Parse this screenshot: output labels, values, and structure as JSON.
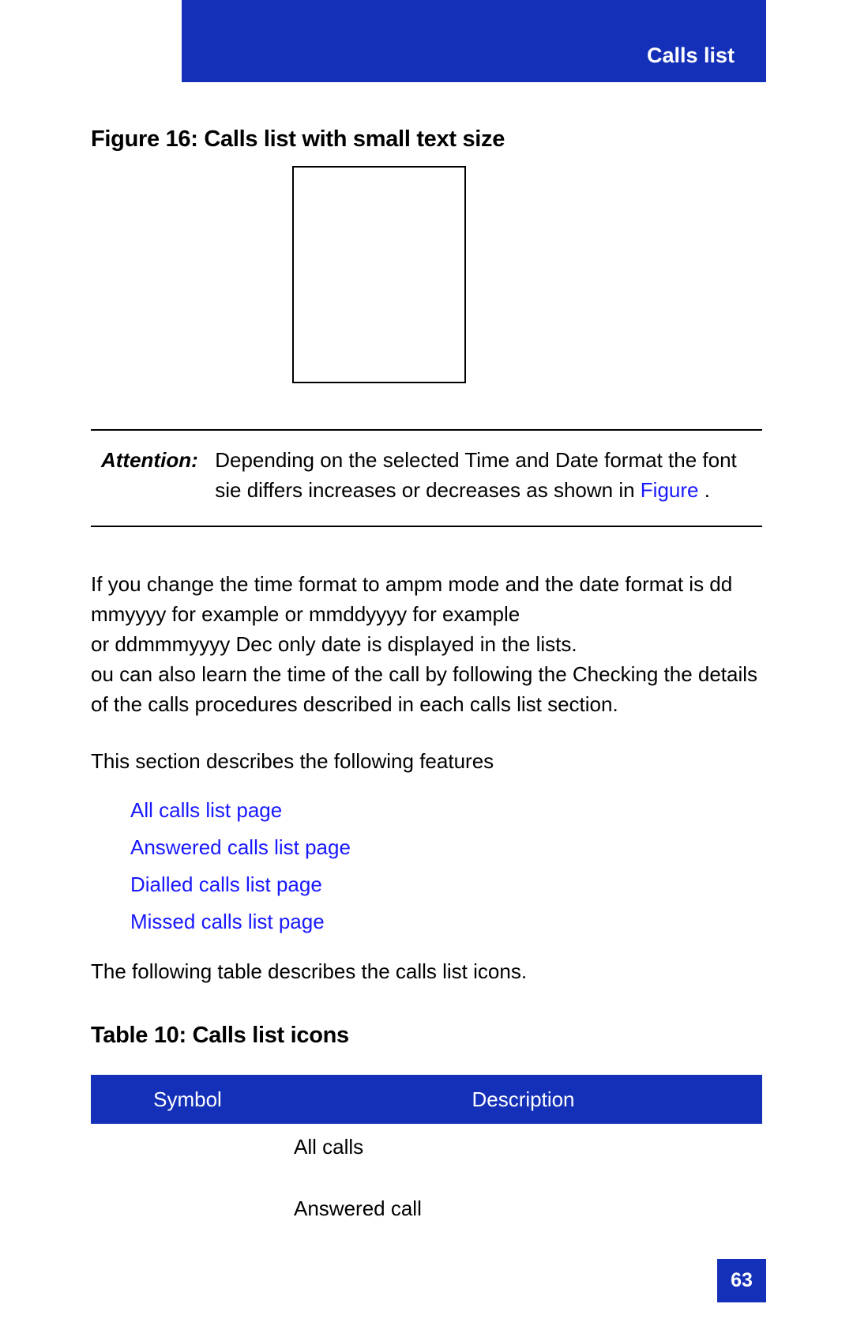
{
  "header": {
    "title": "Calls list"
  },
  "figure": {
    "caption": "Figure 16: Calls list with small text size"
  },
  "attention": {
    "label": "Attention:",
    "text_part1": "Depending on the selected Time and Date format the font sie differs increases or decreases as shown in ",
    "link": "Figure",
    "text_part2": "."
  },
  "para1": "If you change the time format to ampm mode and the date format is dd mmyyyy for example                              or mmddyyyy for example\n or ddmmmyyyy Dec only date is displayed in the lists.\nou can also learn the time of the call by following the Checking the details of the calls procedures described in each calls list section.",
  "para2": "This section describes the following features",
  "links": [
    "All calls list page",
    "Answered calls list page",
    "Dialled calls list page",
    "Missed calls list page"
  ],
  "para3": "The following table describes the calls list icons.",
  "table": {
    "caption": "Table 10: Calls list icons",
    "headers": {
      "symbol": "Symbol",
      "description": "Description"
    },
    "rows": [
      {
        "symbol": "",
        "description": "All calls"
      },
      {
        "symbol": "",
        "description": "Answered call"
      }
    ]
  },
  "page_number": "63"
}
